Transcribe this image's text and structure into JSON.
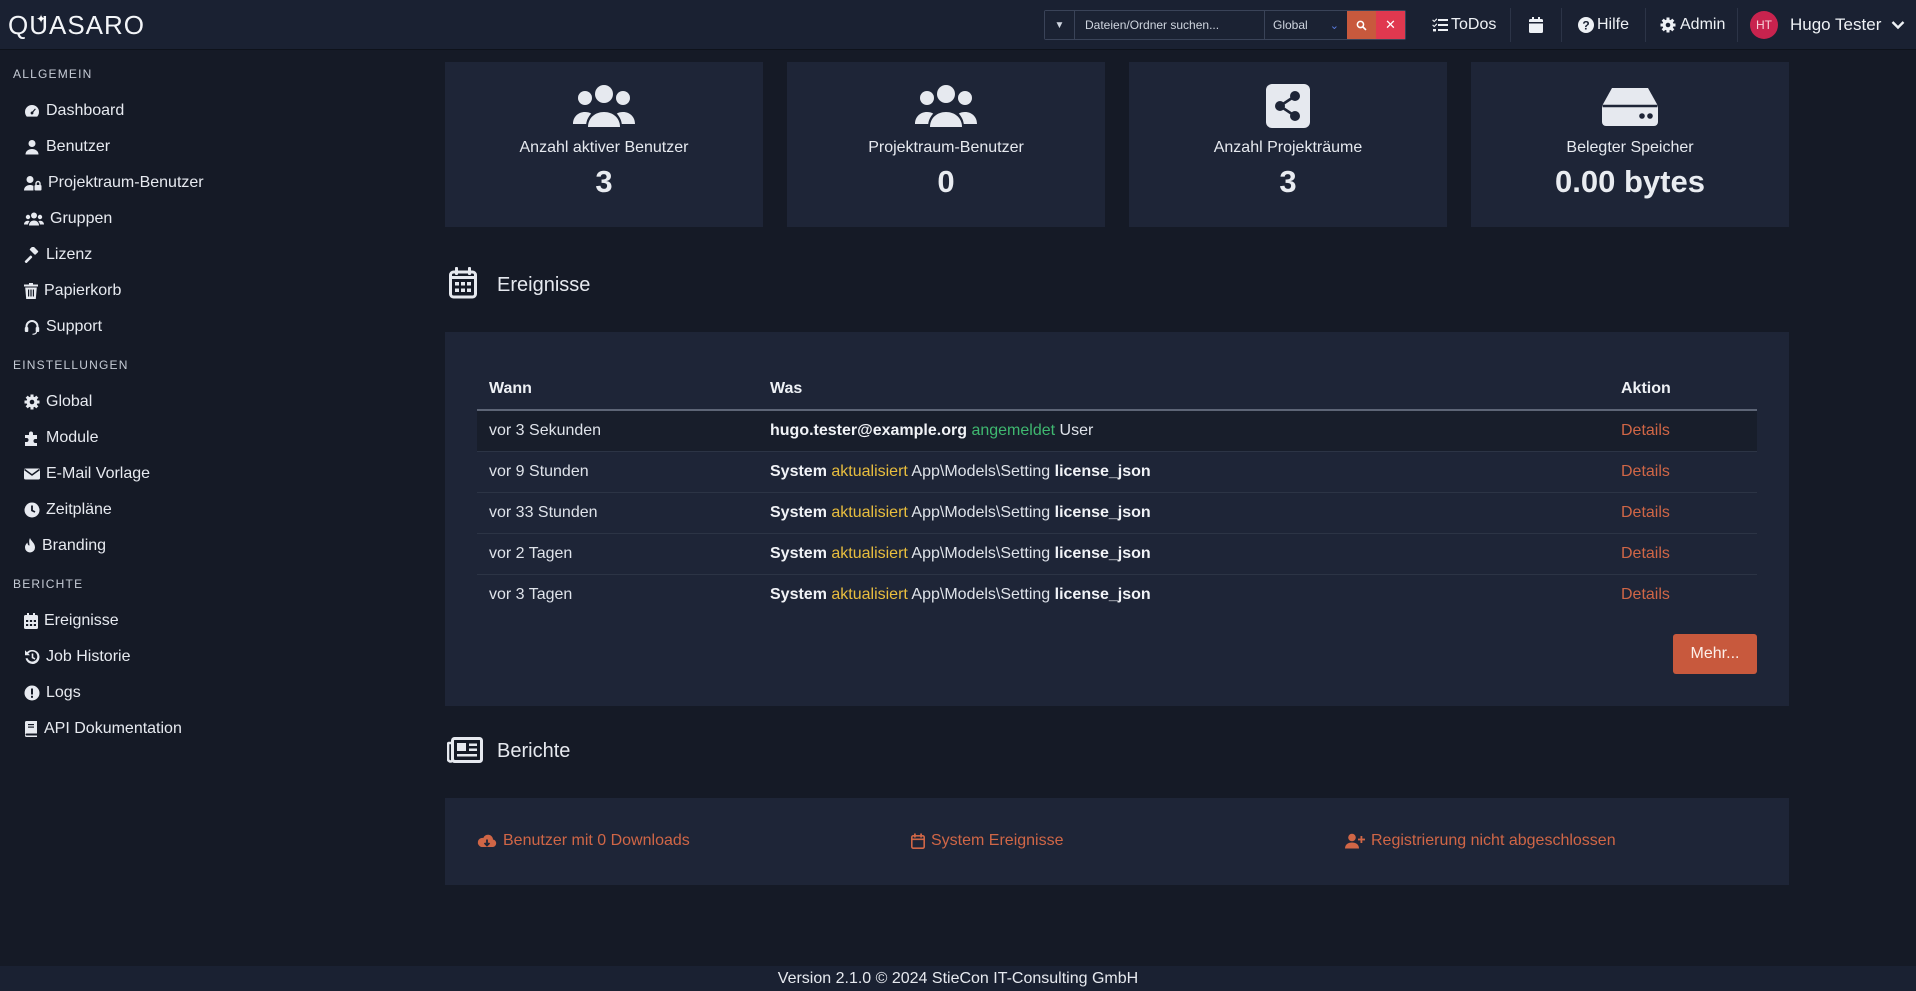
{
  "brand": {
    "name": "QUASARO"
  },
  "topbar": {
    "search_placeholder": "Dateien/Ordner suchen...",
    "scope": "Global",
    "todos_label": "ToDos",
    "help_label": "Hilfe",
    "admin_label": "Admin",
    "user_initials": "HT",
    "user_name": "Hugo Tester"
  },
  "sidebar": {
    "sections": [
      {
        "title": "ALLGEMEIN",
        "items": [
          {
            "label": "Dashboard",
            "icon": "dashboard-icon"
          },
          {
            "label": "Benutzer",
            "icon": "user-icon"
          },
          {
            "label": "Projektraum-Benutzer",
            "icon": "user-lock-icon"
          },
          {
            "label": "Gruppen",
            "icon": "users-icon"
          },
          {
            "label": "Lizenz",
            "icon": "gavel-icon"
          },
          {
            "label": "Papierkorb",
            "icon": "trash-icon"
          },
          {
            "label": "Support",
            "icon": "headset-icon"
          }
        ]
      },
      {
        "title": "EINSTELLUNGEN",
        "items": [
          {
            "label": "Global",
            "icon": "gear-icon"
          },
          {
            "label": "Module",
            "icon": "puzzle-icon"
          },
          {
            "label": "E-Mail Vorlage",
            "icon": "envelope-icon"
          },
          {
            "label": "Zeitpläne",
            "icon": "clock-icon"
          },
          {
            "label": "Branding",
            "icon": "fire-icon"
          }
        ]
      },
      {
        "title": "BERICHTE",
        "items": [
          {
            "label": "Ereignisse",
            "icon": "calendar-icon"
          },
          {
            "label": "Job Historie",
            "icon": "history-icon"
          },
          {
            "label": "Logs",
            "icon": "alert-icon"
          },
          {
            "label": "API Dokumentation",
            "icon": "book-icon"
          }
        ]
      }
    ]
  },
  "stats": [
    {
      "label": "Anzahl aktiver Benutzer",
      "value": "3",
      "icon": "users-icon"
    },
    {
      "label": "Projektraum-Benutzer",
      "value": "0",
      "icon": "users-icon"
    },
    {
      "label": "Anzahl Projekträume",
      "value": "3",
      "icon": "share-icon"
    },
    {
      "label": "Belegter Speicher",
      "value": "0.00 bytes",
      "icon": "hdd-icon"
    }
  ],
  "events": {
    "title": "Ereignisse",
    "columns": [
      "Wann",
      "Was",
      "Aktion"
    ],
    "rows": [
      {
        "when": "vor 3 Sekunden",
        "actor": "hugo.tester@example.org",
        "verb": "angemeldet",
        "object": "User",
        "target": "",
        "action": "Details"
      },
      {
        "when": "vor 9 Stunden",
        "actor": "System",
        "verb": "aktualisiert",
        "object": "App\\Models\\Setting",
        "target": "license_json",
        "action": "Details"
      },
      {
        "when": "vor 33 Stunden",
        "actor": "System",
        "verb": "aktualisiert",
        "object": "App\\Models\\Setting",
        "target": "license_json",
        "action": "Details"
      },
      {
        "when": "vor 2 Tagen",
        "actor": "System",
        "verb": "aktualisiert",
        "object": "App\\Models\\Setting",
        "target": "license_json",
        "action": "Details"
      },
      {
        "when": "vor 3 Tagen",
        "actor": "System",
        "verb": "aktualisiert",
        "object": "App\\Models\\Setting",
        "target": "license_json",
        "action": "Details"
      }
    ],
    "more_label": "Mehr..."
  },
  "reports": {
    "title": "Berichte",
    "links": [
      {
        "label": "Benutzer mit 0 Downloads",
        "icon": "cloud-download-icon"
      },
      {
        "label": "System Ereignisse",
        "icon": "calendar-icon"
      },
      {
        "label": "Registrierung nicht abgeschlossen",
        "icon": "user-plus-icon"
      }
    ]
  },
  "footer": {
    "text": "Version 2.1.0 © 2024 StieCon IT-Consulting GmbH"
  },
  "colors": {
    "accent": "#c8593d",
    "danger": "#e0384f",
    "success": "#3fb870",
    "warning": "#e9be3e",
    "background": "#151a26",
    "card": "#1e2537"
  }
}
